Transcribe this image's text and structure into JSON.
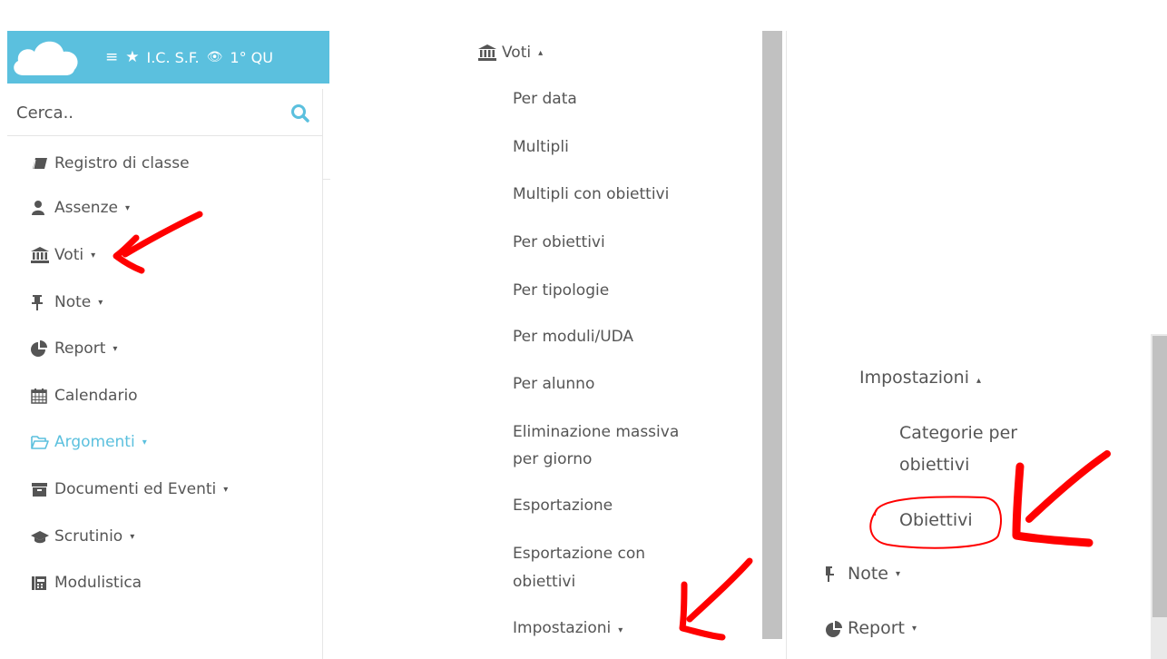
{
  "panel1": {
    "topbar": {
      "menu_glyph": "≡",
      "star_glyph": "★",
      "school": "I.C. S.F.",
      "eye_glyph": "👁",
      "period": "1° QU"
    },
    "search": {
      "placeholder": "Cerca.."
    },
    "nav": [
      {
        "label": "Registro di classe",
        "icon": "book-icon",
        "caret": ""
      },
      {
        "label": "Assenze",
        "icon": "user-icon",
        "caret": "▾"
      },
      {
        "label": "Voti",
        "icon": "bank-icon",
        "caret": "▾"
      },
      {
        "label": "Note",
        "icon": "pin-icon",
        "caret": "▾"
      },
      {
        "label": "Report",
        "icon": "pie-chart-icon",
        "caret": "▾"
      },
      {
        "label": "Calendario",
        "icon": "calendar-icon",
        "caret": ""
      },
      {
        "label": "Argomenti",
        "icon": "folder-open-icon",
        "caret": "▾",
        "active": true
      },
      {
        "label": "Documenti ed Eventi",
        "icon": "archive-icon",
        "caret": "▾"
      },
      {
        "label": "Scrutinio",
        "icon": "graduation-cap-icon",
        "caret": "▾"
      },
      {
        "label": "Modulistica",
        "icon": "forms-icon",
        "caret": ""
      }
    ]
  },
  "panel2": {
    "header": {
      "label": "Voti",
      "caret": "▴"
    },
    "items": [
      "Per data",
      "Multipli",
      "Multipli con obiettivi",
      "Per obiettivi",
      "Per tipologie",
      "Per moduli/UDA",
      "Per alunno",
      "Eliminazione massiva",
      "per giorno",
      "Esportazione",
      "Esportazione con",
      "obiettivi",
      "Impostazioni"
    ],
    "impostazioni_caret": "▾"
  },
  "panel3": {
    "header": {
      "label": "Impostazioni",
      "caret": "▴"
    },
    "sub": [
      "Categorie per",
      "obiettivi",
      "Obiettivi"
    ],
    "nav": [
      {
        "label": "Note",
        "icon": "pin-icon",
        "caret": "▾"
      },
      {
        "label": "Report",
        "icon": "pie-chart-icon",
        "caret": "▾"
      }
    ]
  },
  "colors": {
    "accent": "#5bc0de",
    "text": "#555555",
    "annotation": "#ff0000"
  }
}
